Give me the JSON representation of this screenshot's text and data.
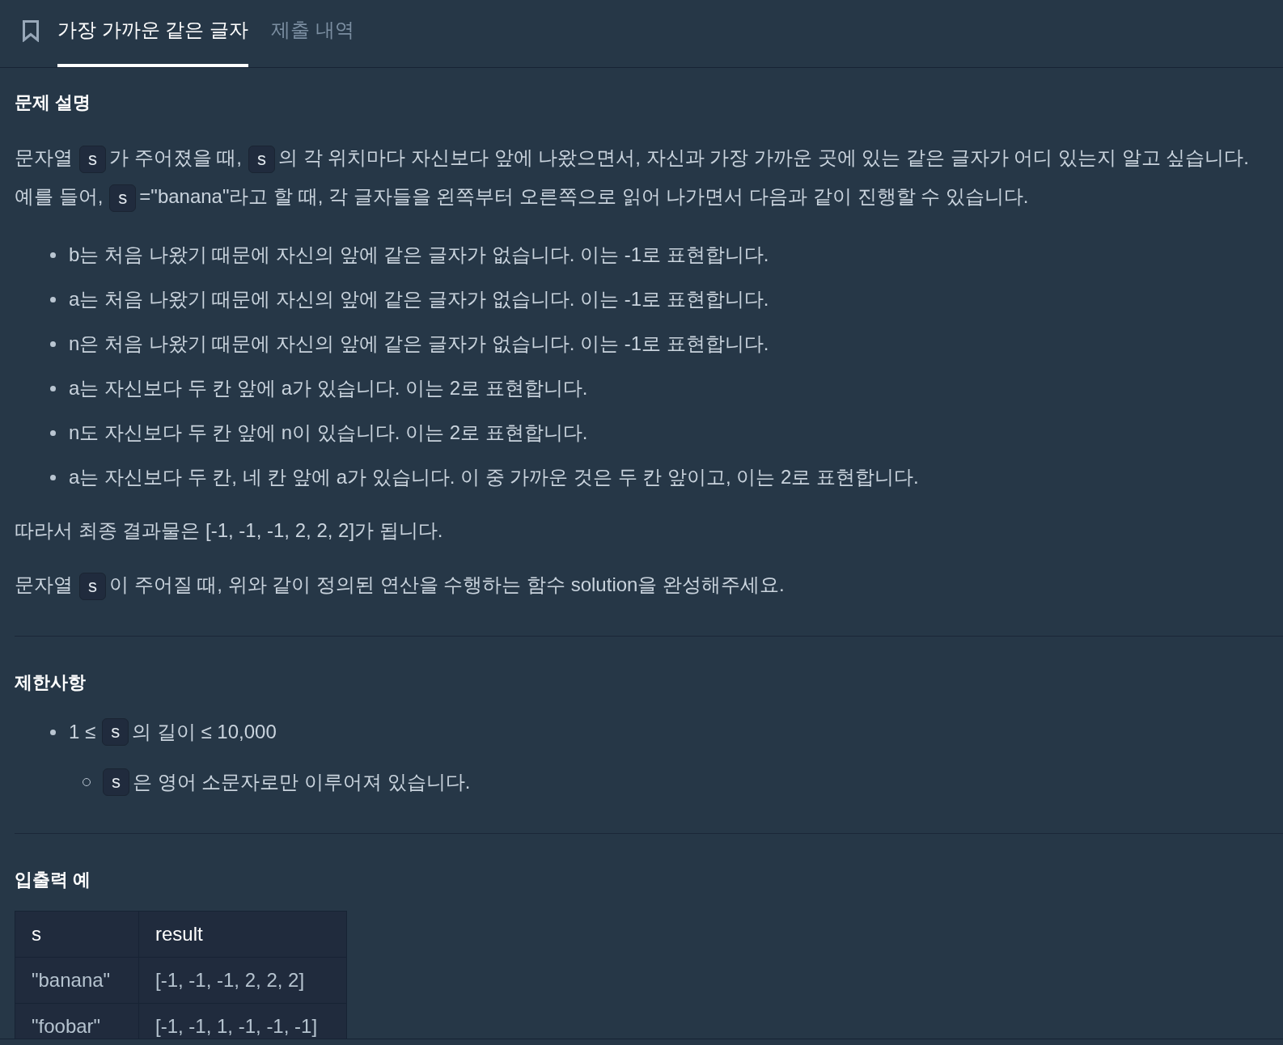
{
  "header": {
    "tabs": [
      {
        "label": "가장 가까운 같은 글자",
        "selected": true
      },
      {
        "label": "제출 내역",
        "selected": false
      }
    ]
  },
  "sections": [
    {
      "heading": "문제 설명",
      "blocks": [
        {
          "kind": "paragraph",
          "lines": [
            [
              {
                "kind": "text",
                "text": "문자열"
              },
              {
                "kind": "code",
                "text": "s"
              },
              {
                "kind": "text",
                "text": "가 주어졌을 때,"
              },
              {
                "kind": "code",
                "text": "s"
              },
              {
                "kind": "text",
                "text": "의 각 위치마다 자신보다 앞에 나왔으면서, 자신과 가장 가까운 곳에 있는 같은 글자가 어디 있는지 알고 싶습니다."
              }
            ],
            [
              {
                "kind": "text",
                "text": "예를 들어,"
              },
              {
                "kind": "code",
                "text": "s"
              },
              {
                "kind": "text",
                "text": "=\"banana\"라고 할 때,  각 글자들을 왼쪽부터 오른쪽으로 읽어 나가면서 다음과 같이 진행할 수 있습니다."
              }
            ]
          ]
        },
        {
          "kind": "list",
          "items": [
            {
              "parts": [
                {
                  "kind": "text",
                  "text": "b는 처음 나왔기 때문에 자신의 앞에 같은 글자가 없습니다. 이는 -1로 표현합니다."
                }
              ]
            },
            {
              "parts": [
                {
                  "kind": "text",
                  "text": "a는 처음 나왔기 때문에 자신의 앞에 같은 글자가 없습니다. 이는 -1로 표현합니다."
                }
              ]
            },
            {
              "parts": [
                {
                  "kind": "text",
                  "text": "n은 처음 나왔기 때문에 자신의 앞에 같은 글자가 없습니다. 이는 -1로 표현합니다."
                }
              ]
            },
            {
              "parts": [
                {
                  "kind": "text",
                  "text": "a는 자신보다 두 칸 앞에 a가 있습니다. 이는 2로 표현합니다."
                }
              ]
            },
            {
              "parts": [
                {
                  "kind": "text",
                  "text": "n도 자신보다 두 칸 앞에 n이 있습니다. 이는 2로 표현합니다."
                }
              ]
            },
            {
              "parts": [
                {
                  "kind": "text",
                  "text": "a는 자신보다 두 칸, 네 칸 앞에 a가 있습니다. 이 중 가까운 것은 두 칸 앞이고, 이는 2로 표현합니다."
                }
              ]
            }
          ]
        },
        {
          "kind": "paragraph",
          "lines": [
            [
              {
                "kind": "text",
                "text": "따라서 최종 결과물은 [-1, -1, -1, 2, 2, 2]가 됩니다."
              }
            ]
          ]
        },
        {
          "kind": "paragraph",
          "lines": [
            [
              {
                "kind": "text",
                "text": "문자열"
              },
              {
                "kind": "code",
                "text": "s"
              },
              {
                "kind": "text",
                "text": "이 주어질 때, 위와 같이 정의된 연산을 수행하는 함수 solution을 완성해주세요."
              }
            ]
          ]
        }
      ]
    },
    {
      "heading": "제한사항",
      "blocks": [
        {
          "kind": "list",
          "items": [
            {
              "parts": [
                {
                  "kind": "text",
                  "text": "1 ≤"
                },
                {
                  "kind": "code",
                  "text": "s"
                },
                {
                  "kind": "text",
                  "text": "의 길이 ≤ 10,000"
                }
              ],
              "children": [
                {
                  "parts": [
                    {
                      "kind": "code",
                      "text": "s"
                    },
                    {
                      "kind": "text",
                      "text": "은 영어 소문자로만 이루어져 있습니다."
                    }
                  ]
                }
              ]
            }
          ]
        }
      ]
    },
    {
      "heading": "입출력 예",
      "blocks": [
        {
          "kind": "table",
          "columns": [
            "s",
            "result"
          ],
          "rows": [
            [
              "\"banana\"",
              "[-1, -1, -1, 2, 2, 2]"
            ],
            [
              "\"foobar\"",
              "[-1, -1, 1, -1, -1, -1]"
            ]
          ]
        }
      ]
    }
  ]
}
